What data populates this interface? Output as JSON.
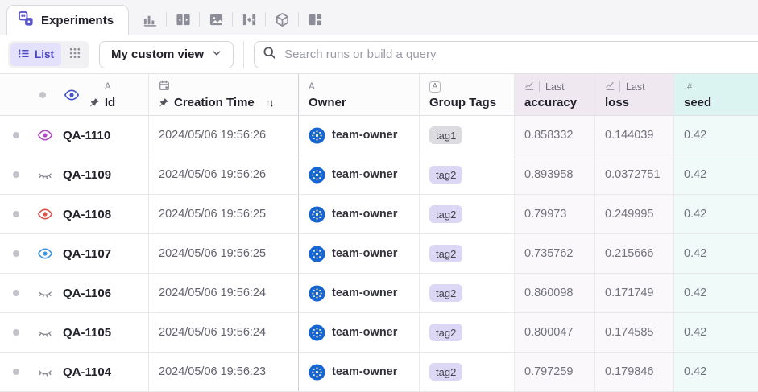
{
  "tabs": {
    "active_label": "Experiments",
    "icons": [
      "charts",
      "compare",
      "images",
      "parallel-coordinates",
      "artifacts",
      "widgets"
    ]
  },
  "toolbar": {
    "list_label": "List",
    "view_selector": "My custom view",
    "search_placeholder": "Search runs or build a query"
  },
  "icons": {
    "sort_asc": "↑",
    "sort_desc": "↓"
  },
  "table": {
    "header": {
      "id": {
        "type": "A",
        "label": "Id"
      },
      "creation_time": {
        "label": "Creation Time"
      },
      "owner": {
        "type": "A",
        "label": "Owner"
      },
      "group_tags": {
        "type": "A",
        "label": "Group Tags"
      },
      "accuracy": {
        "agg": "Last",
        "label": "accuracy"
      },
      "loss": {
        "agg": "Last",
        "label": "loss"
      },
      "seed": {
        "type": ".#",
        "label": "seed"
      }
    },
    "rows": [
      {
        "id": "QA-1110",
        "eye": "purple",
        "creation_time": "2024/05/06 19:56:26",
        "owner": "team-owner",
        "tag": "tag1",
        "tag_variant": "gray",
        "accuracy": "0.858332",
        "loss": "0.144039",
        "seed": "0.42"
      },
      {
        "id": "QA-1109",
        "eye": "closed",
        "creation_time": "2024/05/06 19:56:26",
        "owner": "team-owner",
        "tag": "tag2",
        "tag_variant": "purple",
        "accuracy": "0.893958",
        "loss": "0.0372751",
        "seed": "0.42"
      },
      {
        "id": "QA-1108",
        "eye": "red",
        "creation_time": "2024/05/06 19:56:25",
        "owner": "team-owner",
        "tag": "tag2",
        "tag_variant": "purple",
        "accuracy": "0.79973",
        "loss": "0.249995",
        "seed": "0.42"
      },
      {
        "id": "QA-1107",
        "eye": "blue",
        "creation_time": "2024/05/06 19:56:25",
        "owner": "team-owner",
        "tag": "tag2",
        "tag_variant": "purple",
        "accuracy": "0.735762",
        "loss": "0.215666",
        "seed": "0.42"
      },
      {
        "id": "QA-1106",
        "eye": "closed",
        "creation_time": "2024/05/06 19:56:24",
        "owner": "team-owner",
        "tag": "tag2",
        "tag_variant": "purple",
        "accuracy": "0.860098",
        "loss": "0.171749",
        "seed": "0.42"
      },
      {
        "id": "QA-1105",
        "eye": "closed",
        "creation_time": "2024/05/06 19:56:24",
        "owner": "team-owner",
        "tag": "tag2",
        "tag_variant": "purple",
        "accuracy": "0.800047",
        "loss": "0.174585",
        "seed": "0.42"
      },
      {
        "id": "QA-1104",
        "eye": "closed",
        "creation_time": "2024/05/06 19:56:23",
        "owner": "team-owner",
        "tag": "tag2",
        "tag_variant": "purple",
        "accuracy": "0.797259",
        "loss": "0.179846",
        "seed": "0.42"
      }
    ]
  },
  "colors": {
    "accent": "#5b54cf",
    "list_chip_bg": "#e3e1fb",
    "list_chip_text": "#4c46c4",
    "header_metric_bg": "#f0e8f1",
    "header_seed_bg": "#dcf4f1",
    "cell_metric_bg": "#faf8fb",
    "cell_seed_bg": "#effaf9",
    "tag_gray_bg": "#dbdbe0",
    "tag_purple_bg": "#dcd7f5",
    "eye_purple": "#b04dc3",
    "eye_red": "#d9544a",
    "eye_blue": "#3f97e3",
    "eye_header": "#4353c9",
    "avatar_bg": "#1565d2",
    "avatar_fg": "#f3eec0",
    "closed_eye": "#8a8a94"
  }
}
